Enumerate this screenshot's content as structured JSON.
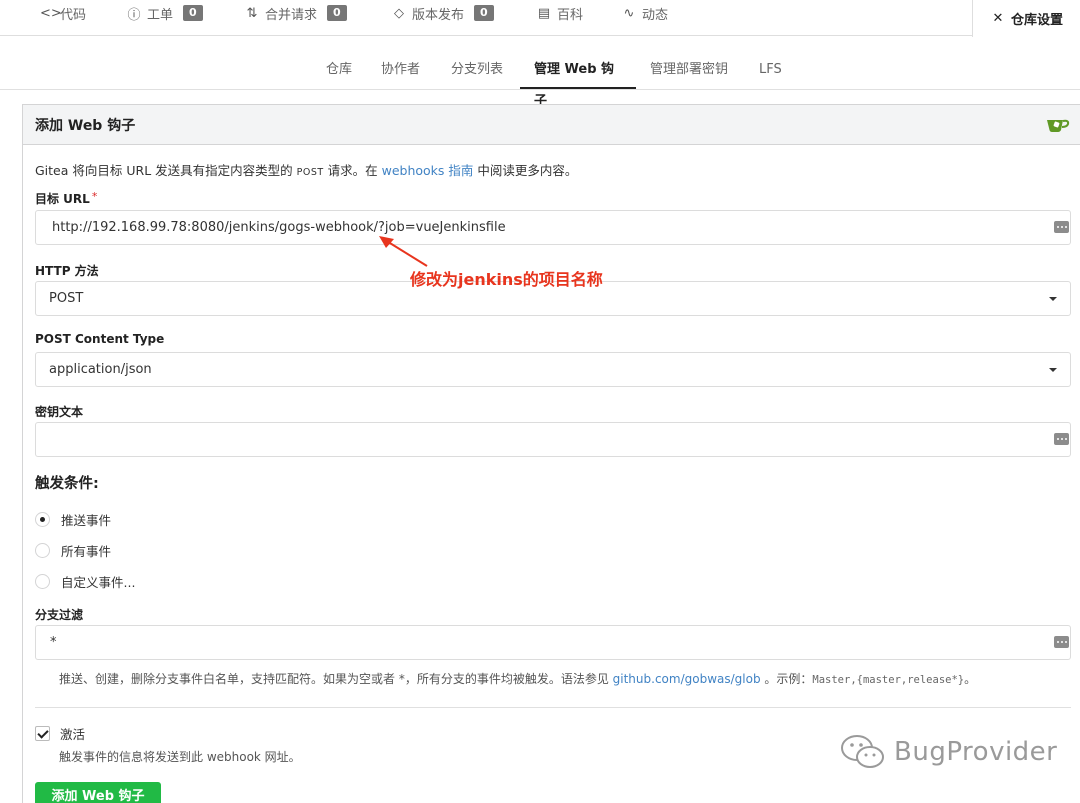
{
  "repo_nav": {
    "items": [
      {
        "icon": "code-icon",
        "glyph": "<>",
        "label": "代码"
      },
      {
        "icon": "issue-icon",
        "glyph": "ⓘ",
        "label": "工单",
        "count": "0"
      },
      {
        "icon": "pull-request-icon",
        "glyph": "⇅",
        "label": "合并请求",
        "count": "0"
      },
      {
        "icon": "tag-icon",
        "glyph": "◇",
        "label": "版本发布",
        "count": "0"
      },
      {
        "icon": "wiki-icon",
        "glyph": "▤",
        "label": "百科"
      },
      {
        "icon": "activity-icon",
        "glyph": "∿",
        "label": "动态"
      }
    ],
    "active": {
      "icon": "tools-icon",
      "glyph": "✕",
      "label": "仓库设置"
    }
  },
  "tabs": [
    {
      "label": "仓库"
    },
    {
      "label": "协作者"
    },
    {
      "label": "分支列表"
    },
    {
      "label": "管理 Web 钩子",
      "active": true
    },
    {
      "label": "管理部署密钥"
    },
    {
      "label": "LFS"
    }
  ],
  "panel": {
    "title": "添加 Web 钩子",
    "desc_prefix": "Gitea 将向目标 URL 发送具有指定内容类型的 ",
    "desc_post": "POST",
    "desc_mid": " 请求。在 ",
    "desc_link": "webhooks 指南",
    "desc_suffix": " 中阅读更多内容。"
  },
  "form": {
    "url_label": "目标 URL",
    "url_required": "*",
    "url_value": "http://192.168.99.78:8080/jenkins/gogs-webhook/?job=vueJenkinsfile",
    "method_label": "HTTP 方法",
    "method_value": "POST",
    "content_type_label": "POST Content Type",
    "content_type_value": "application/json",
    "secret_label": "密钥文本",
    "secret_value": "",
    "trigger_title": "触发条件:",
    "trigger_options": [
      {
        "label": "推送事件",
        "selected": true
      },
      {
        "label": "所有事件",
        "selected": false
      },
      {
        "label": "自定义事件...",
        "selected": false
      }
    ],
    "branch_filter_label": "分支过滤",
    "branch_filter_value": "*",
    "help_prefix": "推送、创建，删除分支事件白名单，支持匹配符。如果为空或者 *，所有分支的事件均被触发。语法参见 ",
    "help_link": "github.com/gobwas/glob",
    "help_mid": " 。示例：",
    "help_example": "Master,{master,release*}",
    "help_suffix": "。",
    "active_label": "激活",
    "active_checked": true,
    "active_help": "触发事件的信息将发送到此 webhook 网址。",
    "submit_label": "添加 Web 钩子"
  },
  "annotation": "修改为jenkins的项目名称",
  "watermark": "BugProvider",
  "colors": {
    "primary_green": "#21ba45",
    "link": "#4183c4",
    "annotation_red": "#e8351e",
    "badge": "#767676"
  }
}
